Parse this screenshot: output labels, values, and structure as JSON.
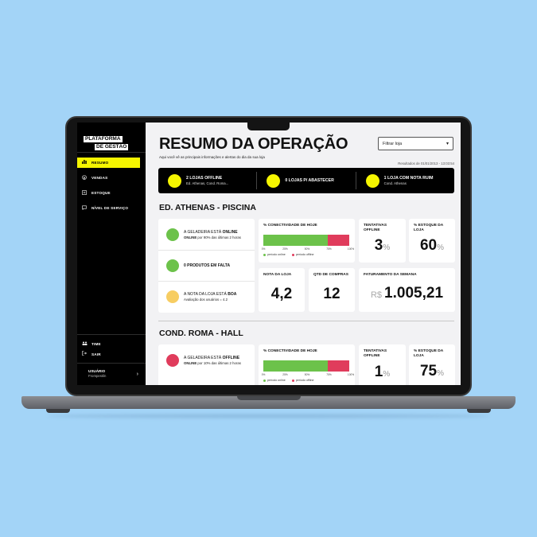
{
  "sidebar": {
    "logo_line1": "PLATAFORMA",
    "logo_line2": "DE GESTÃO",
    "nav": [
      {
        "label": "RESUMO",
        "icon": "bar-chart-icon"
      },
      {
        "label": "VENDAS",
        "icon": "dollar-icon"
      },
      {
        "label": "ESTOQUE",
        "icon": "clipboard-icon"
      },
      {
        "label": "NÍVEL DE SERVIÇO",
        "icon": "chat-icon"
      }
    ],
    "bottom": [
      {
        "label": "TIME",
        "icon": "team-icon"
      },
      {
        "label": "SAIR",
        "icon": "logout-icon"
      }
    ],
    "user_label": "USUÁRIO",
    "user_sub": "Frompestiln"
  },
  "header": {
    "title": "RESUMO DA OPERAÇÃO",
    "subtitle": "Aqui você vê as principais informações e alertas do dia da sua loja",
    "filter_placeholder": "Filtrar loja",
    "updated": "Resultados de 01/01/2013 - 13:03:54"
  },
  "alerts": [
    {
      "title": "2 LOJAS OFFLINE",
      "sub": "Ed. Athenas, Cond. Roma..."
    },
    {
      "title": "0 LOJAS P/ ABASTECER",
      "sub": ""
    },
    {
      "title": "1 LOJA COM NOTA RUIM",
      "sub": "Cond. Athenas"
    }
  ],
  "stores": [
    {
      "name": "ED. ATHENAS - PISCINA",
      "status": [
        {
          "pre": "A GELADEIRA ESTÁ ",
          "strong": "ONLINE",
          "sub_strong": "ONLINE",
          "sub": " por 90% das últimas 2 horas",
          "color": "#6cc24a"
        },
        {
          "pre": "0 PRODUTOS EM FALTA",
          "strong": "",
          "sub_strong": "",
          "sub": "",
          "color": "#6cc24a"
        },
        {
          "pre": "A NOTA DA LOJA ESTÁ ",
          "strong": "BOA",
          "sub_strong": "",
          "sub": "Avaliação dos usuários = 4.2",
          "color": "#f7cd62"
        }
      ],
      "connectivity_label": "% CONECTIVIDADE DE HOJE",
      "online_pct": 75,
      "offline_label_tentativas": "TENTATIVAS OFFLINE",
      "tentativas": "3",
      "estoque_label": "% ESTOQUE DA LOJA",
      "estoque": "60",
      "nota_label": "NOTA DA LOJA",
      "nota": "4,2",
      "compras_label": "QTD DE COMPRAS",
      "compras": "12",
      "faturamento_label": "FATURAMENTO DA SEMANA",
      "currency": "R$",
      "faturamento": "1.005,21"
    },
    {
      "name": "COND. ROMA - HALL",
      "status": [
        {
          "pre": "A GELADEIRA ESTÁ ",
          "strong": "OFFLINE",
          "sub_strong": "ONLINE",
          "sub": " por 10% das últimas 2 horas",
          "color": "#e03c5c"
        }
      ],
      "connectivity_label": "% CONECTIVIDADE DE HOJE",
      "online_pct": 75,
      "offline_label_tentativas": "TENTATIVAS OFFLINE",
      "tentativas": "1",
      "estoque_label": "% ESTOQUE DA LOJA",
      "estoque": "75"
    }
  ],
  "chart": {
    "ticks": [
      "0%",
      "25%",
      "50%",
      "75%",
      "100%"
    ],
    "legend_online": "período online",
    "legend_offline": "período offline",
    "unit": "%"
  },
  "colors": {
    "accent": "#f5f500",
    "online": "#6cc24a",
    "offline": "#e03c5c",
    "warn": "#f7cd62"
  }
}
